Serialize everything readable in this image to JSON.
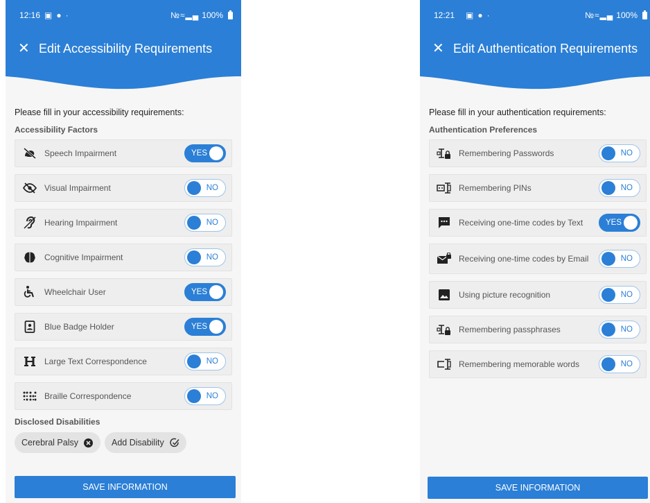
{
  "left": {
    "status": {
      "time": "12:16",
      "battery": "100%"
    },
    "title": "Edit Accessibility Requirements",
    "intro": "Please fill in your accessibility requirements:",
    "section_title": "Accessibility Factors",
    "items": [
      {
        "label": "Speech Impairment",
        "icon": "speech-impairment-icon",
        "toggle": "YES"
      },
      {
        "label": "Visual Impairment",
        "icon": "visual-impairment-icon",
        "toggle": "NO"
      },
      {
        "label": "Hearing Impairment",
        "icon": "hearing-impairment-icon",
        "toggle": "NO"
      },
      {
        "label": "Cognitive Impairment",
        "icon": "brain-icon",
        "toggle": "NO"
      },
      {
        "label": "Wheelchair User",
        "icon": "wheelchair-icon",
        "toggle": "YES"
      },
      {
        "label": "Blue Badge Holder",
        "icon": "badge-icon",
        "toggle": "YES"
      },
      {
        "label": "Large Text Correspondence",
        "icon": "large-text-icon",
        "toggle": "NO"
      },
      {
        "label": "Braille Correspondence",
        "icon": "braille-icon",
        "toggle": "NO"
      }
    ],
    "disclosed_title": "Disclosed Disabilities",
    "chips": [
      {
        "label": "Cerebral Palsy",
        "icon": "remove-icon"
      },
      {
        "label": "Add Disability",
        "icon": "add-check-icon"
      }
    ],
    "save_label": "SAVE INFORMATION"
  },
  "right": {
    "status": {
      "time": "12:21",
      "battery": "100%"
    },
    "title": "Edit Authentication Requirements",
    "intro": "Please fill in your authentication requirements:",
    "section_title": "Authentication Preferences",
    "items": [
      {
        "label": "Remembering Passwords",
        "icon": "password-lock-icon",
        "toggle": "NO"
      },
      {
        "label": "Remembering PINs",
        "icon": "pin-field-icon",
        "toggle": "NO"
      },
      {
        "label": "Receiving one-time codes by Text",
        "icon": "sms-icon",
        "toggle": "YES"
      },
      {
        "label": "Receiving one-time codes by Email",
        "icon": "email-lock-icon",
        "toggle": "NO"
      },
      {
        "label": "Using picture recognition",
        "icon": "image-icon",
        "toggle": "NO"
      },
      {
        "label": "Remembering passphrases",
        "icon": "passphrase-lock-icon",
        "toggle": "NO"
      },
      {
        "label": "Remembering memorable words",
        "icon": "text-cursor-icon",
        "toggle": "NO"
      }
    ],
    "save_label": "SAVE INFORMATION"
  },
  "colors": {
    "primary": "#2b7fd6",
    "background": "#f6f6f6",
    "row": "#eeeeee"
  }
}
